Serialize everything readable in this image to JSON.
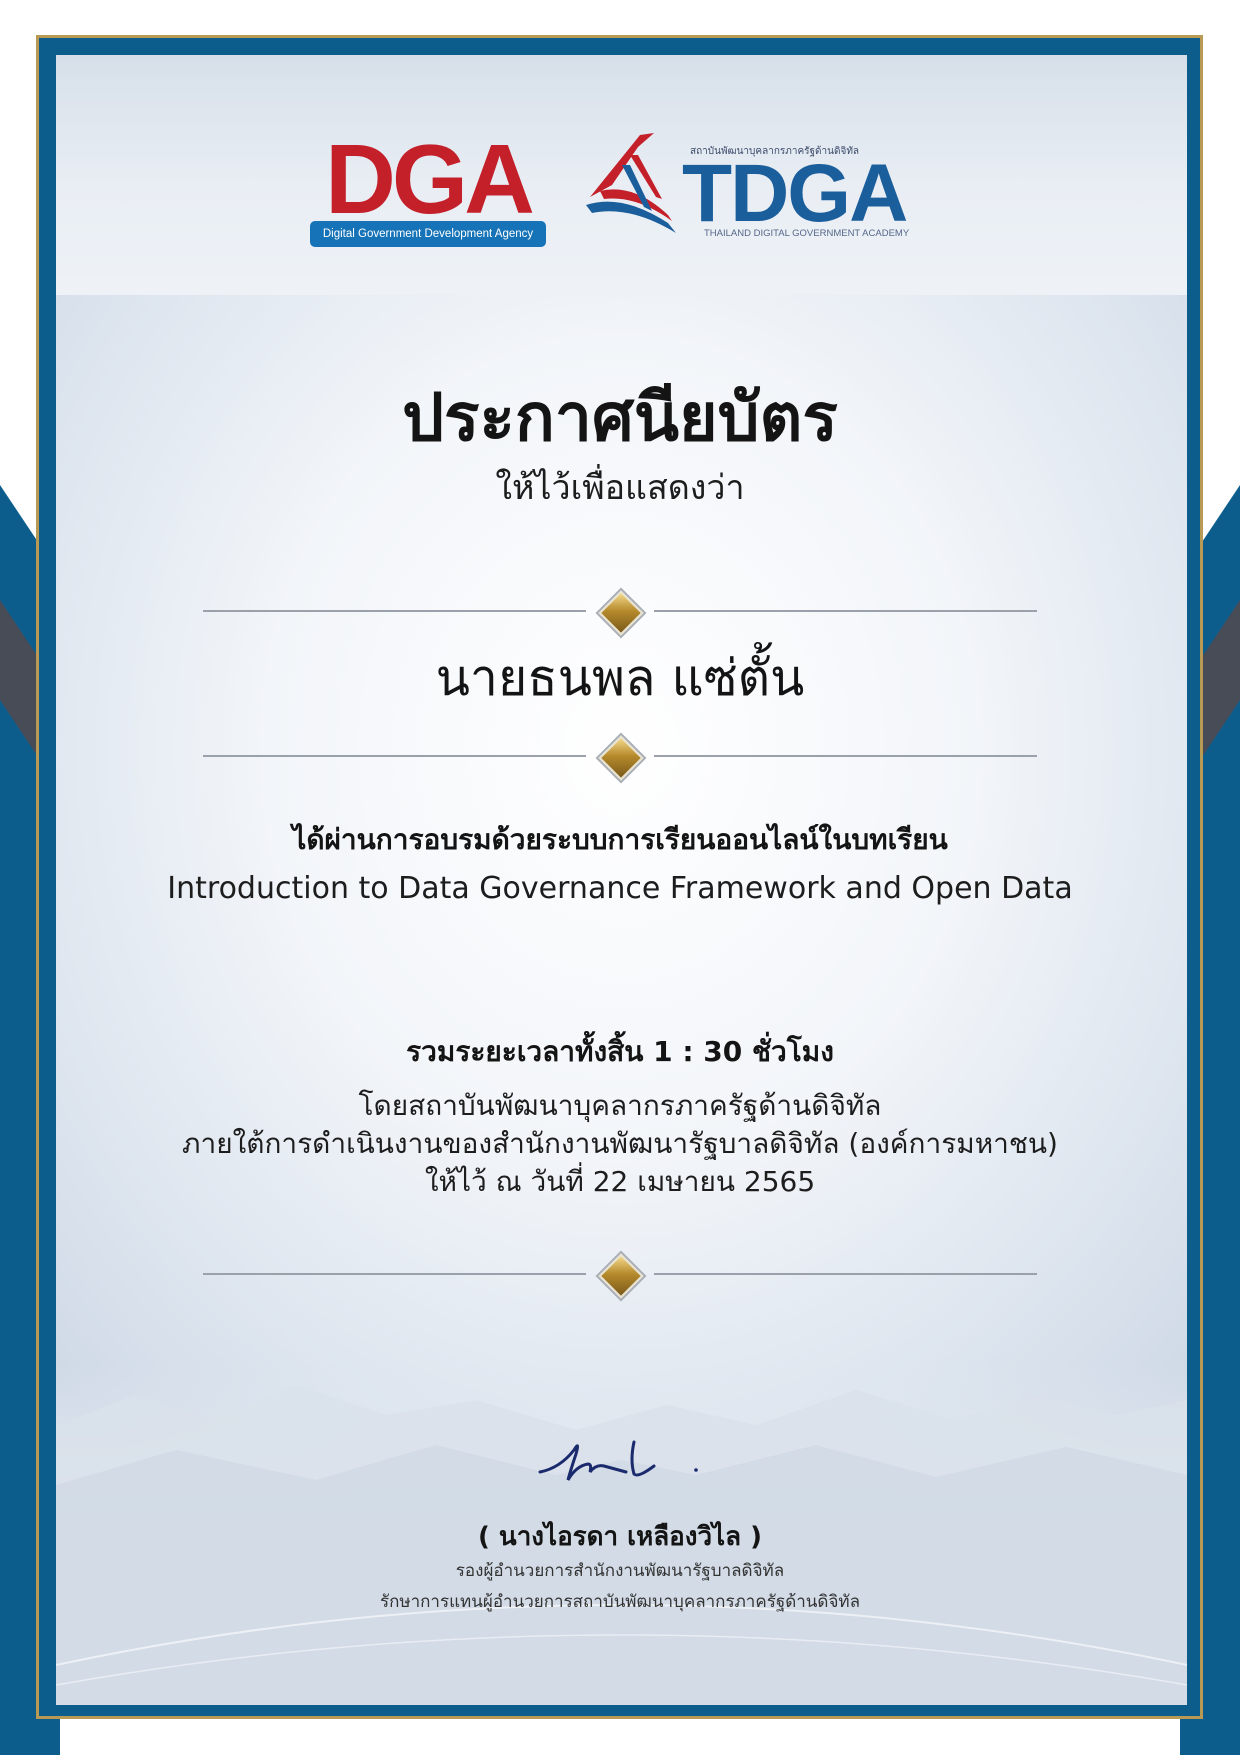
{
  "logos": {
    "dga": {
      "word": "DGA",
      "tagline": "Digital Government Development Agency"
    },
    "tdga": {
      "thai_name": "สถาบันพัฒนาบุคลากรภาครัฐด้านดิจิทัล",
      "word": "TDGA",
      "english_name": "THAILAND DIGITAL GOVERNMENT ACADEMY"
    }
  },
  "certificate": {
    "title": "ประกาศนียบัตร",
    "subtitle": "ให้ไว้เพื่อแสดงว่า",
    "recipient": "นายธนพล แซ่ตั้น",
    "passed_text": "ได้ผ่านการอบรมด้วยระบบการเรียนออนไลน์ในบทเรียน",
    "course_name": "Introduction to Data Governance Framework and Open Data",
    "total_hours": "รวมระยะเวลาทั้งสิ้น 1 : 30 ชั่วโมง",
    "issuer_line": "โดยสถาบันพัฒนาบุคลากรภาครัฐด้านดิจิทัล",
    "under_line": "ภายใต้การดำเนินงานของสำนักงานพัฒนารัฐบาลดิจิทัล (องค์การมหาชน)",
    "date_line": "ให้ไว้ ณ วันที่ 22 เมษายน 2565"
  },
  "signatory": {
    "name": "( นางไอรดา เหลืองวิไล )",
    "position_1": "รองผู้อำนวยการสำนักงานพัฒนารัฐบาลดิจิทัล",
    "position_2": "รักษาการแทนผู้อำนวยการสถาบันพัฒนาบุคลากรภาครัฐด้านดิจิทัล"
  },
  "colors": {
    "frame_blue": "#0d5d8c",
    "gold": "#b89a55",
    "dga_red": "#c4202a",
    "tdga_blue": "#1b5e9c"
  },
  "icons": {
    "divider": "gold-diamond-ornament",
    "signature": "handwritten-signature"
  }
}
